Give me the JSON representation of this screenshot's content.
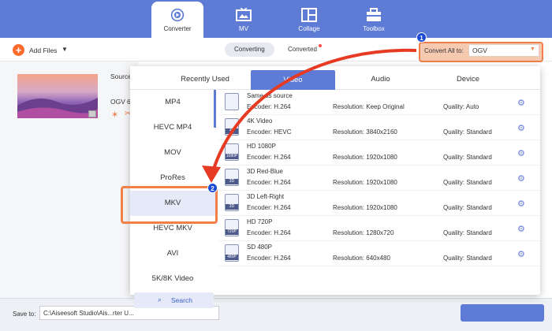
{
  "nav": {
    "tabs": [
      {
        "label": "Converter"
      },
      {
        "label": "MV"
      },
      {
        "label": "Collage"
      },
      {
        "label": "Toolbox"
      }
    ]
  },
  "toolbar": {
    "add_files": "Add Files",
    "converting": "Converting",
    "converted": "Converted",
    "convert_all_label": "Convert All to:",
    "convert_all_value": "OGV"
  },
  "file": {
    "source_label": "Source",
    "format": "OGV",
    "format_extra": "6"
  },
  "format_panel": {
    "tabs": [
      "Recently Used",
      "Video",
      "Audio",
      "Device"
    ],
    "formats": [
      "MP4",
      "HEVC MP4",
      "MOV",
      "ProRes",
      "MKV",
      "HEVC MKV",
      "AVI",
      "5K/8K Video"
    ],
    "search_label": "Search",
    "presets": [
      {
        "icon": "",
        "name": "Same as source",
        "encoder": "Encoder: H.264",
        "resolution": "Resolution: Keep Original",
        "quality": "Quality: Auto"
      },
      {
        "icon": "4K",
        "name": "4K Video",
        "encoder": "Encoder: HEVC",
        "resolution": "Resolution: 3840x2160",
        "quality": "Quality: Standard"
      },
      {
        "icon": "1080P",
        "name": "HD 1080P",
        "encoder": "Encoder: H.264",
        "resolution": "Resolution: 1920x1080",
        "quality": "Quality: Standard"
      },
      {
        "icon": "3D",
        "name": "3D Red-Blue",
        "encoder": "Encoder: H.264",
        "resolution": "Resolution: 1920x1080",
        "quality": "Quality: Standard"
      },
      {
        "icon": "3D",
        "name": "3D Left-Right",
        "encoder": "Encoder: H.264",
        "resolution": "Resolution: 1920x1080",
        "quality": "Quality: Standard"
      },
      {
        "icon": "720P",
        "name": "HD 720P",
        "encoder": "Encoder: H.264",
        "resolution": "Resolution: 1280x720",
        "quality": "Quality: Standard"
      },
      {
        "icon": "480P",
        "name": "SD 480P",
        "encoder": "Encoder: H.264",
        "resolution": "Resolution: 640x480",
        "quality": "Quality: Standard"
      }
    ]
  },
  "bottom": {
    "save_to_label": "Save to:",
    "save_path": "C:\\Aiseesoft Studio\\Ais...rter U..."
  },
  "annotations": {
    "step1": "1",
    "step2": "2"
  },
  "colors": {
    "accent": "#5e7bd6",
    "highlight": "#f07f4a",
    "arrow": "#e63a22",
    "selected_format_bg": "#e5e9f8",
    "badge": "#1a4bd6"
  }
}
